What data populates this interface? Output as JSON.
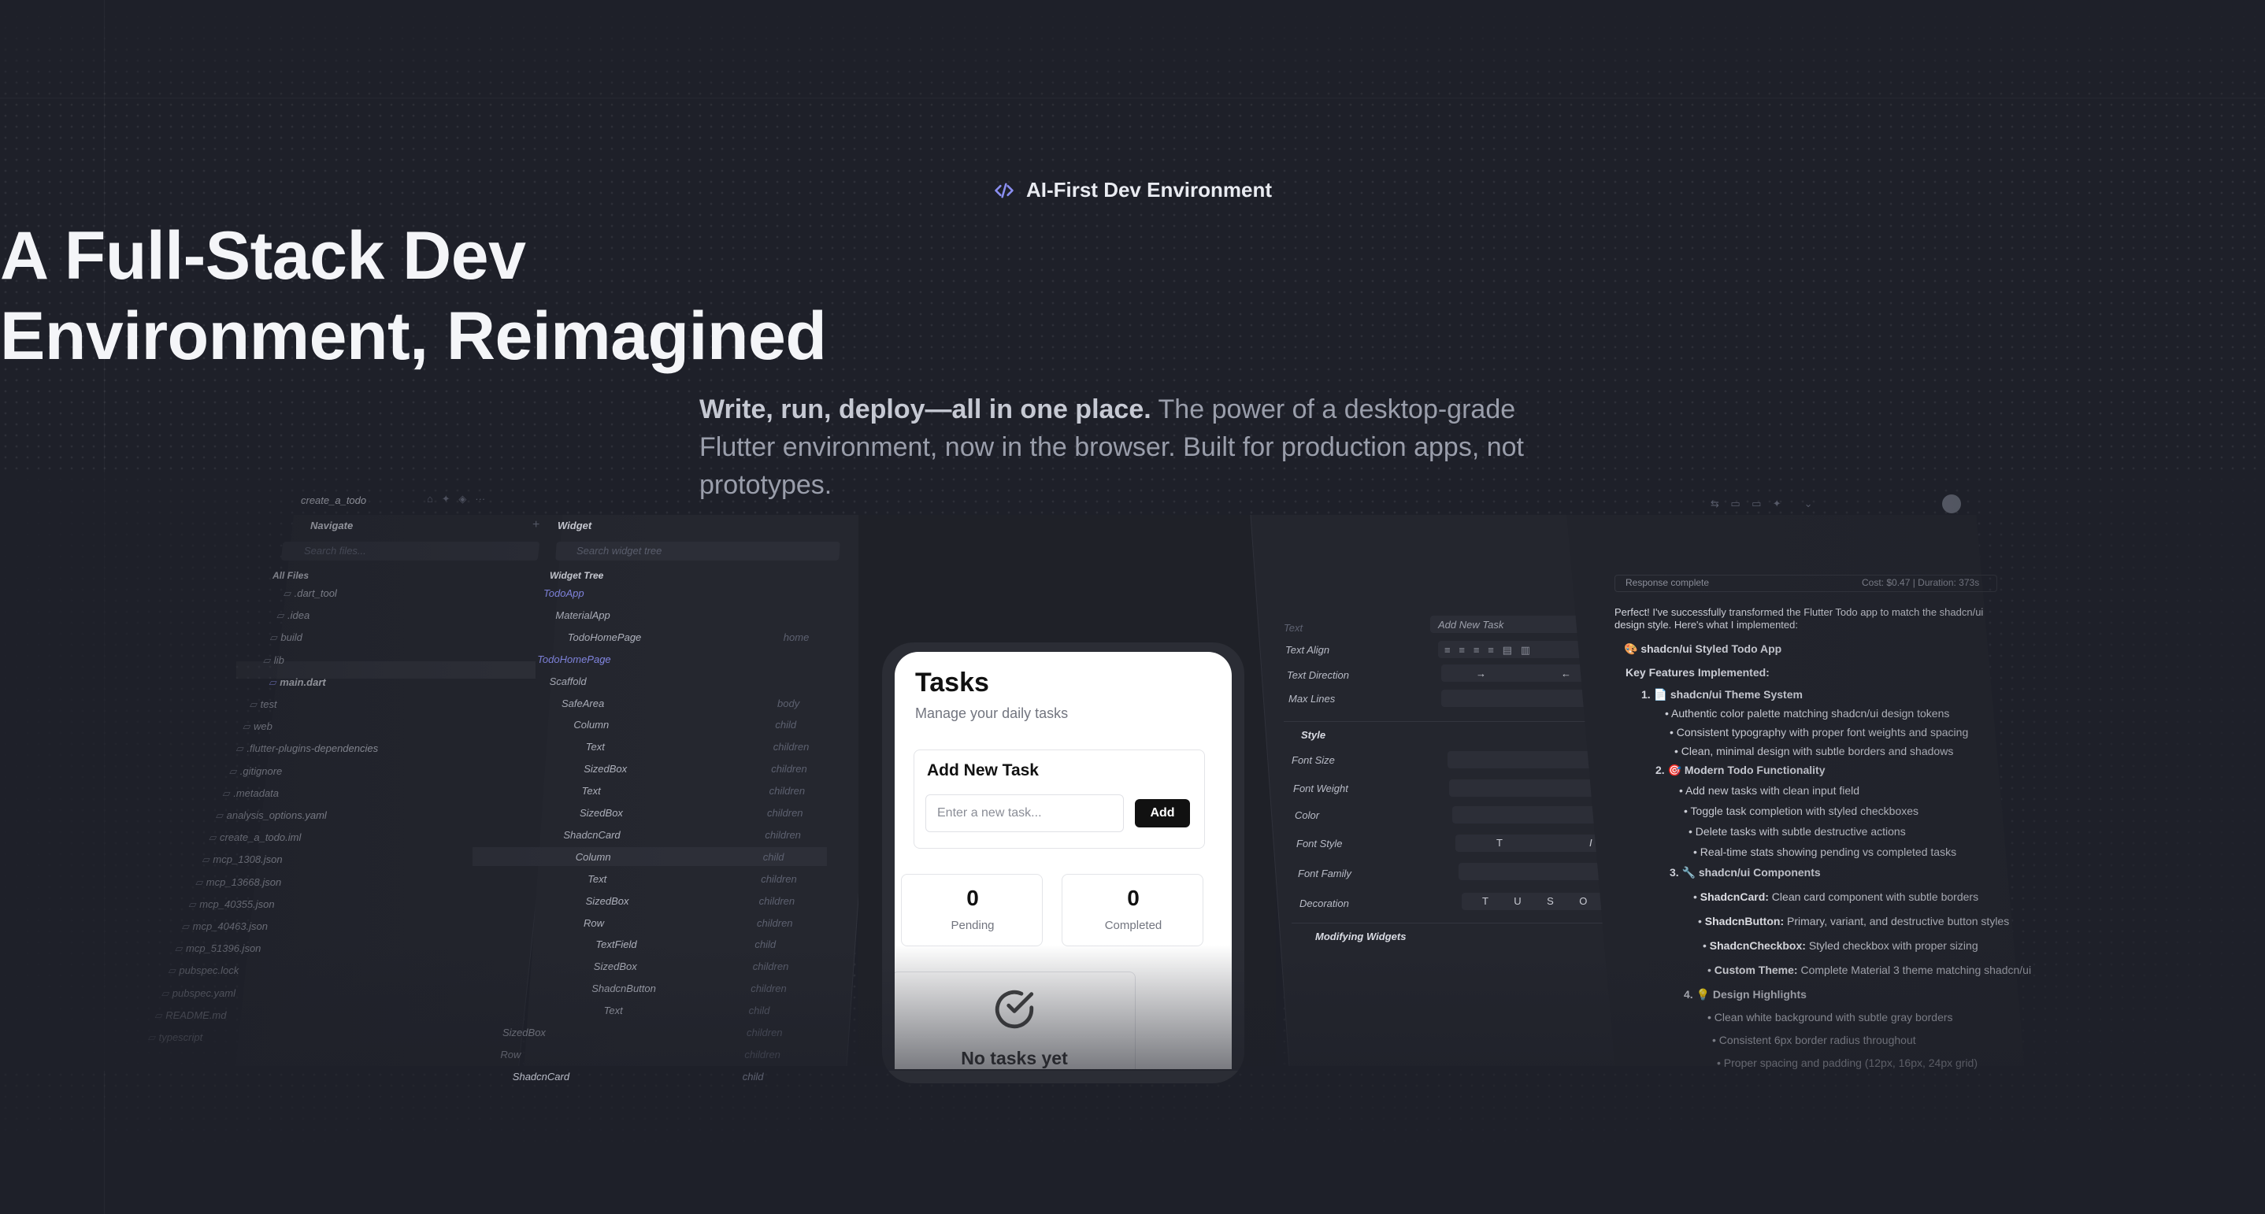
{
  "hero": {
    "eyebrow": "AI-First Dev Environment",
    "headline_line1": "A Full-Stack Dev",
    "headline_line2": "Environment, Reimagined",
    "sub_bold": "Write, run, deploy—all in one place.",
    "sub_rest": " The power of a desktop-grade Flutter environment, now in the browser. Built for production apps, not prototypes."
  },
  "colors": {
    "background": "#1e2029",
    "accent_icon": "#8b8ff2",
    "button_dark": "#111111"
  },
  "ide": {
    "project_name": "create_a_todo",
    "navigate_title": "Navigate",
    "search_files": "Search files...",
    "all_files": "All Files",
    "files": [
      ".dart_tool",
      ".idea",
      "build",
      "lib",
      "main.dart",
      "test",
      "web",
      ".flutter-plugins-dependencies",
      ".gitignore",
      ".metadata",
      "analysis_options.yaml",
      "create_a_todo.iml",
      "mcp_1308.json",
      "mcp_13668.json",
      "mcp_40355.json",
      "mcp_40463.json",
      "mcp_51396.json",
      "pubspec.lock",
      "pubspec.yaml",
      "README.md",
      "typescript"
    ],
    "widget_title": "Widget",
    "search_widget": "Search widget tree",
    "widget_tree_title": "Widget Tree",
    "widget_tree": [
      {
        "name": "TodoApp",
        "role": ""
      },
      {
        "name": "MaterialApp",
        "role": ""
      },
      {
        "name": "TodoHomePage",
        "role": "home"
      },
      {
        "name": "TodoHomePage",
        "role": ""
      },
      {
        "name": "Scaffold",
        "role": ""
      },
      {
        "name": "SafeArea",
        "role": "body"
      },
      {
        "name": "Column",
        "role": "child"
      },
      {
        "name": "Text",
        "role": "children"
      },
      {
        "name": "SizedBox",
        "role": "children"
      },
      {
        "name": "Text",
        "role": "children"
      },
      {
        "name": "SizedBox",
        "role": "children"
      },
      {
        "name": "ShadcnCard",
        "role": "children"
      },
      {
        "name": "Column",
        "role": "child"
      },
      {
        "name": "Text",
        "role": "children"
      },
      {
        "name": "SizedBox",
        "role": "children"
      },
      {
        "name": "Row",
        "role": "children"
      },
      {
        "name": "TextField",
        "role": "child"
      },
      {
        "name": "SizedBox",
        "role": "children"
      },
      {
        "name": "ShadcnButton",
        "role": "children"
      },
      {
        "name": "Text",
        "role": "child"
      },
      {
        "name": "SizedBox",
        "role": "children"
      },
      {
        "name": "Row",
        "role": "children"
      },
      {
        "name": "ShadcnCard",
        "role": "child"
      }
    ],
    "properties": {
      "text_label": "Text",
      "text_value": "Add New Task",
      "text_align": "Text Align",
      "text_direction": "Text Direction",
      "max_lines": "Max Lines",
      "style_title": "Style",
      "font_size": "Font Size",
      "font_weight": "Font Weight",
      "color": "Color",
      "font_style": "Font Style",
      "font_family": "Font Family",
      "decoration": "Decoration",
      "modifying_widgets": "Modifying Widgets"
    },
    "phone": {
      "title": "Tasks",
      "subtitle": "Manage your daily tasks",
      "card_title": "Add New Task",
      "input_placeholder": "Enter a new task...",
      "add_button": "Add",
      "pending_count": "0",
      "pending_label": "Pending",
      "completed_count": "0",
      "completed_label": "Completed",
      "empty_text": "No tasks yet"
    },
    "chat": {
      "response_complete": "Response complete",
      "cost": "Cost: $0.47 | Duration: 373s",
      "intro": "Perfect! I've successfully transformed the Flutter Todo app to match the shadcn/ui design style. Here's what I implemented:",
      "app_title": "🎨 shadcn/ui Styled Todo App",
      "key_features": "Key Features Implemented:",
      "s1": "1. 📄 shadcn/ui Theme System",
      "s1_items": [
        "Authentic color palette matching shadcn/ui design tokens",
        "Consistent typography with proper font weights and spacing",
        "Clean, minimal design with subtle borders and shadows"
      ],
      "s2": "2. 🎯 Modern Todo Functionality",
      "s2_items": [
        "Add new tasks with clean input field",
        "Toggle task completion with styled checkboxes",
        "Delete tasks with subtle destructive actions",
        "Real-time stats showing pending vs completed tasks"
      ],
      "s3": "3. 🔧 shadcn/ui Components",
      "s3_items": [
        {
          "b": "ShadcnCard:",
          "t": " Clean card component with subtle borders"
        },
        {
          "b": "ShadcnButton:",
          "t": " Primary, variant, and destructive button styles"
        },
        {
          "b": "ShadcnCheckbox:",
          "t": " Styled checkbox with proper sizing"
        },
        {
          "b": "Custom Theme:",
          "t": " Complete Material 3 theme matching shadcn/ui"
        }
      ],
      "s4": "4. 💡 Design Highlights",
      "s4_items": [
        "Clean white background with subtle gray borders",
        "Consistent 6px border radius throughout",
        "Proper spacing and padding (12px, 16px, 24px grid)"
      ]
    }
  }
}
